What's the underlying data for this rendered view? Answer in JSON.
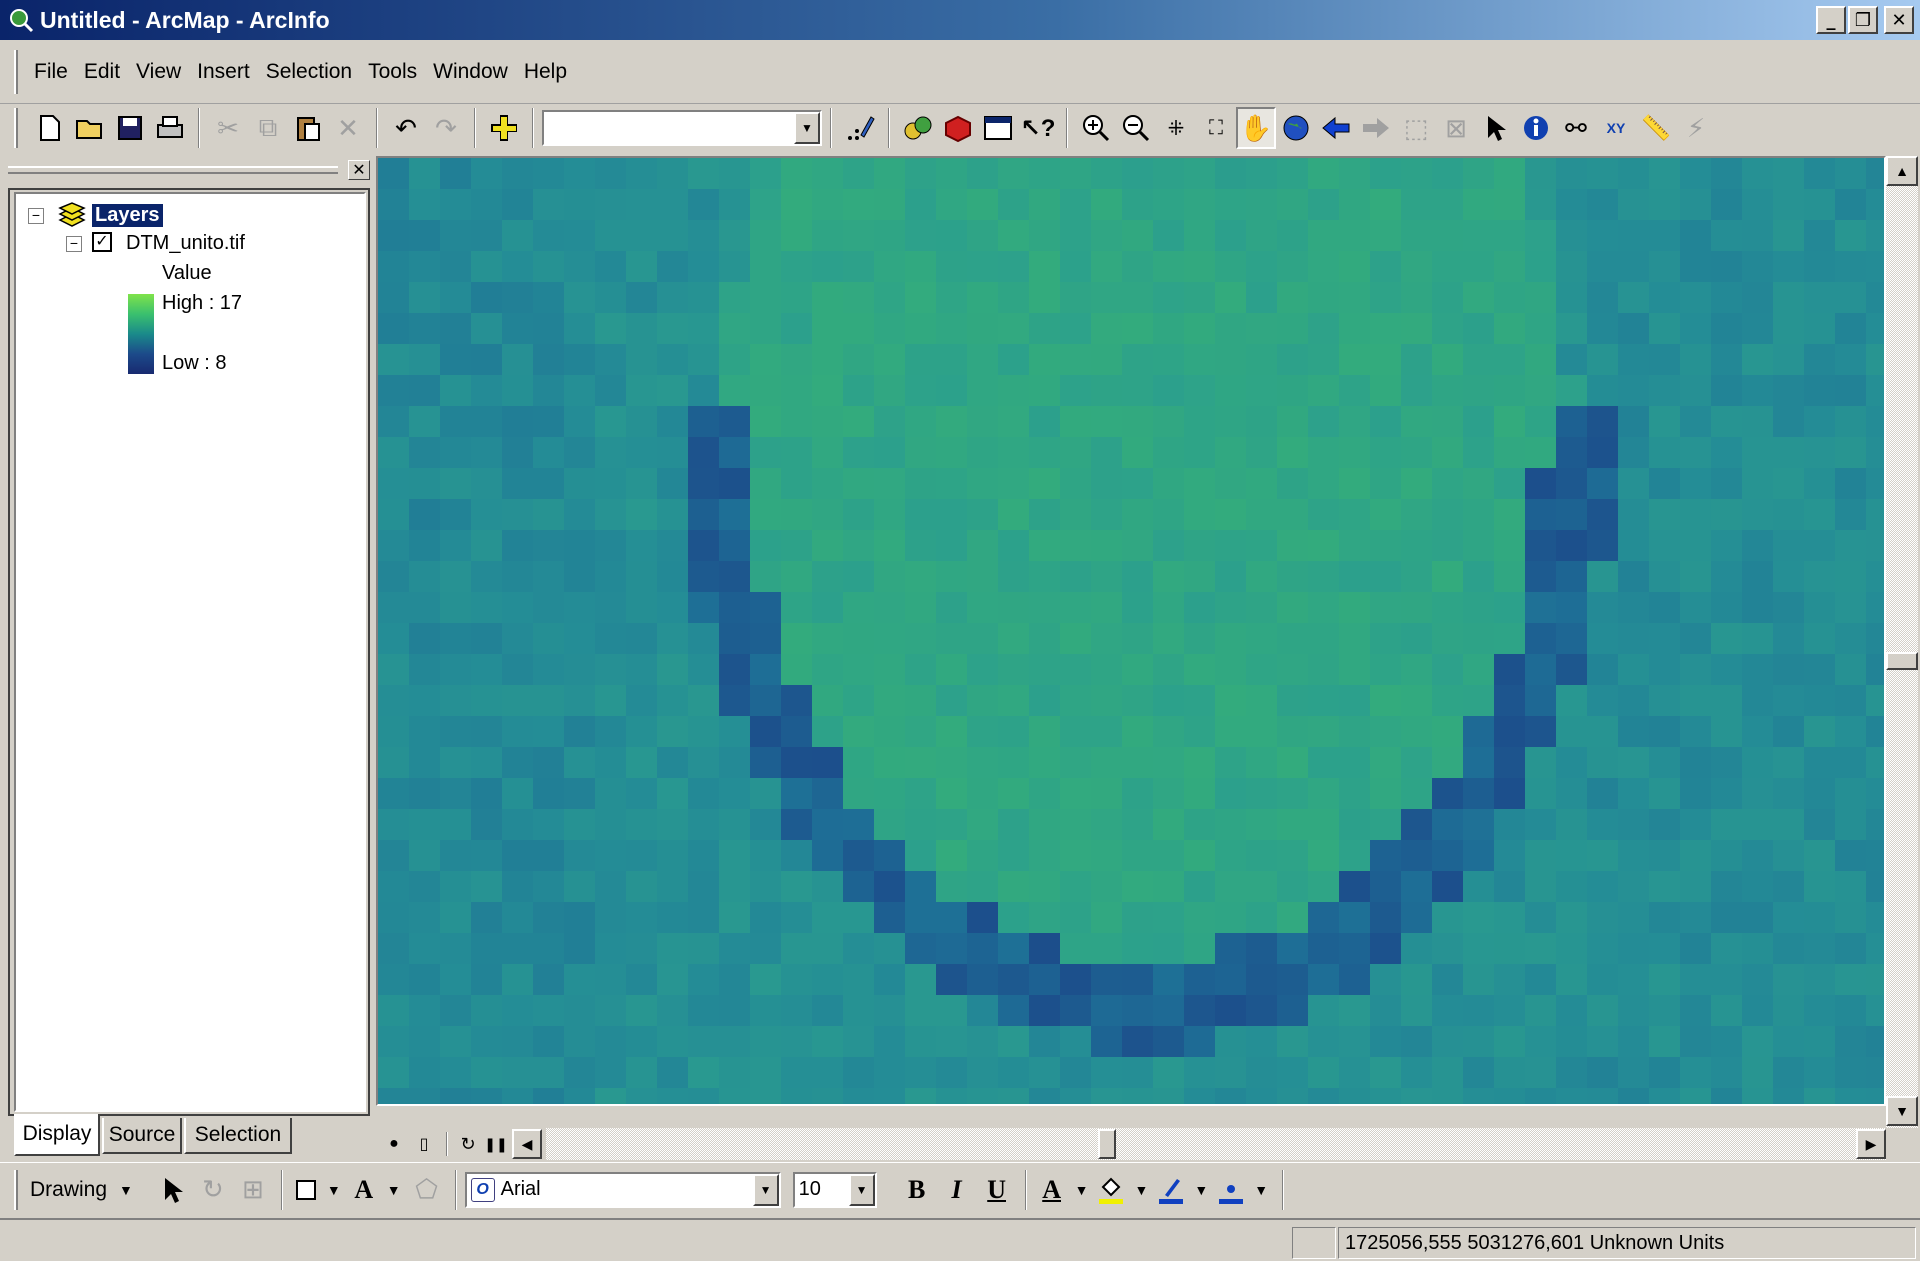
{
  "window": {
    "title": "Untitled - ArcMap - ArcInfo"
  },
  "menu": [
    "File",
    "Edit",
    "View",
    "Insert",
    "Selection",
    "Tools",
    "Window",
    "Help"
  ],
  "toc": {
    "root": "Layers",
    "layer": "DTM_unito.tif",
    "field": "Value",
    "high": "High : 17",
    "low": "Low : 8",
    "tabs": [
      "Display",
      "Source",
      "Selection"
    ]
  },
  "drawing": {
    "label": "Drawing",
    "font": "Arial",
    "size": "10",
    "bold": "B",
    "italic": "I",
    "underline": "U"
  },
  "status": {
    "coords": "1725056,555  5031276,601 Unknown Units"
  },
  "colors": {
    "ramp_high": "#7fe34a",
    "ramp_low": "#182a70",
    "titlebar": "#0a246a",
    "selection": "#0a246a"
  }
}
